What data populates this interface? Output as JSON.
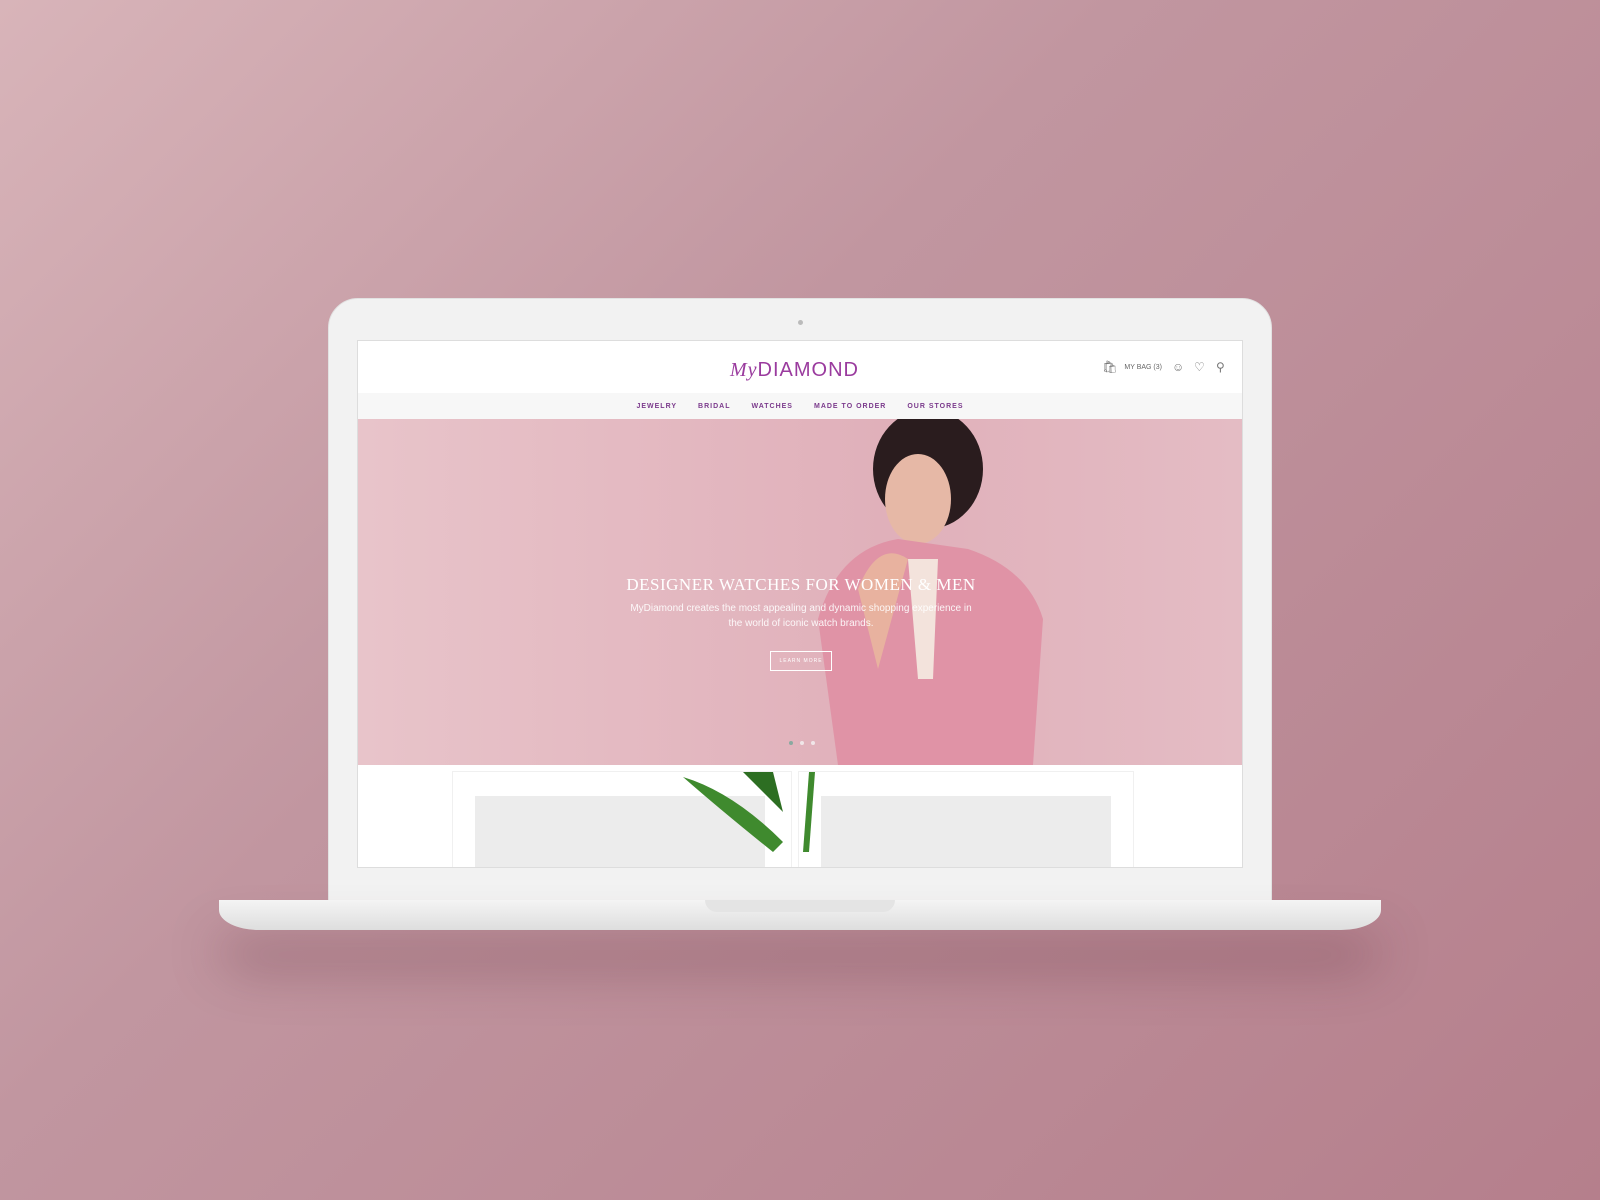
{
  "site": {
    "logo_prefix": "My",
    "logo_main": "DIAMOND",
    "brand_color": "#9a3b9e"
  },
  "header": {
    "bag_label": "MY BAG (3)",
    "icons": [
      "shopping-bag-icon",
      "user-icon",
      "heart-icon",
      "search-icon"
    ]
  },
  "nav": {
    "items": [
      "JEWELRY",
      "BRIDAL",
      "WATCHES",
      "MADE TO ORDER",
      "OUR STORES"
    ]
  },
  "hero": {
    "title": "DESIGNER WATCHES FOR WOMEN & MEN",
    "line1": "MyDiamond creates the most appealing and dynamic shopping experience in",
    "line2": "the world of iconic watch brands.",
    "button": "LEARN MORE",
    "slide_count": 3,
    "active_slide": 1
  }
}
